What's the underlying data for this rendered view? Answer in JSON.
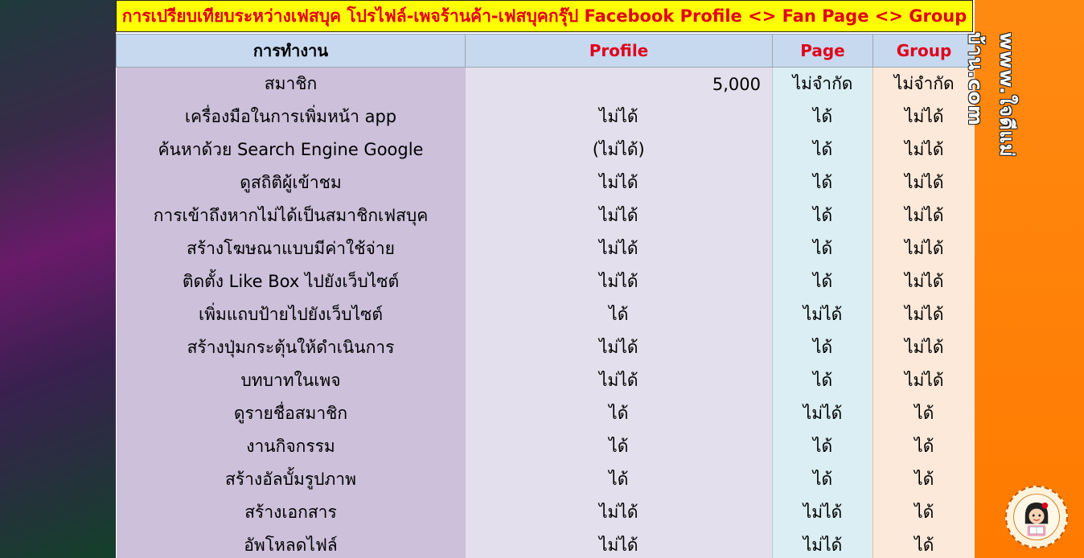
{
  "title": "การเปรียบเทียบระหว่างเฟสบุค โปรไฟล์-เพจร้านค้า-เฟสบุคกรุ๊ป Facebook Profile <> Fan Page <> Group",
  "headers": {
    "activity": "การทำงาน",
    "profile": "Profile",
    "page": "Page",
    "group": "Group"
  },
  "rows": [
    {
      "activity": "สมาชิก",
      "profile": "5,000",
      "page": "ไม่จำกัด",
      "group": "ไม่จำกัด"
    },
    {
      "activity": "เครื่องมือในการเพิ่มหน้า app",
      "profile": "ไม่ได้",
      "page": "ได้",
      "group": "ไม่ได้"
    },
    {
      "activity": "ค้นหาด้วย Search Engine Google",
      "profile": "(ไม่ได้)",
      "page": "ได้",
      "group": "ไม่ได้"
    },
    {
      "activity": "ดูสถิติผู้เข้าชม",
      "profile": "ไม่ได้",
      "page": "ได้",
      "group": "ไม่ได้"
    },
    {
      "activity": "การเข้าถึงหากไม่ได้เป็นสมาชิกเฟสบุค",
      "profile": "ไม่ได้",
      "page": "ได้",
      "group": "ไม่ได้"
    },
    {
      "activity": "สร้างโฆษณาแบบมีค่าใช้จ่าย",
      "profile": "ไม่ได้",
      "page": "ได้",
      "group": "ไม่ได้"
    },
    {
      "activity": "ติดตั้ง Like Box ไปยังเว็บไซต์",
      "profile": "ไม่ได้",
      "page": "ได้",
      "group": "ไม่ได้"
    },
    {
      "activity": "เพิ่มแถบป้ายไปยังเว็บไซต์",
      "profile": "ได้",
      "page": "ไม่ได้",
      "group": "ไม่ได้"
    },
    {
      "activity": "สร้างปุ่มกระตุ้นให้ดำเนินการ",
      "profile": "ไม่ได้",
      "page": "ได้",
      "group": "ไม่ได้"
    },
    {
      "activity": "บทบาทในเพจ",
      "profile": "ไม่ได้",
      "page": "ได้",
      "group": "ไม่ได้"
    },
    {
      "activity": "ดูรายชื่อสมาชิก",
      "profile": "ได้",
      "page": "ไม่ได้",
      "group": "ได้"
    },
    {
      "activity": "งานกิจกรรม",
      "profile": "ได้",
      "page": "ได้",
      "group": "ได้"
    },
    {
      "activity": "สร้างอัลบั้มรูปภาพ",
      "profile": "ได้",
      "page": "ได้",
      "group": "ได้"
    },
    {
      "activity": "สร้างเอกสาร",
      "profile": "ไม่ได้",
      "page": "ไม่ได้",
      "group": "ได้"
    },
    {
      "activity": "อัพโหลดไฟล์",
      "profile": "ไม่ได้",
      "page": "ไม่ได้",
      "group": "ได้"
    }
  ],
  "watermark": "www.ใจดีแม่บ้าน.com",
  "colors": {
    "title_bg": "#ffff00",
    "title_text": "#e0001b",
    "header_bg": "#c6d9ef",
    "activity_bg": "#ccc0da",
    "profile_bg": "#e4dfec",
    "page_bg": "#daeef3",
    "group_bg": "#fde9d9",
    "side_orange": "#ff7a00"
  },
  "icons": {
    "logo": "girl-reading-logo-icon"
  }
}
